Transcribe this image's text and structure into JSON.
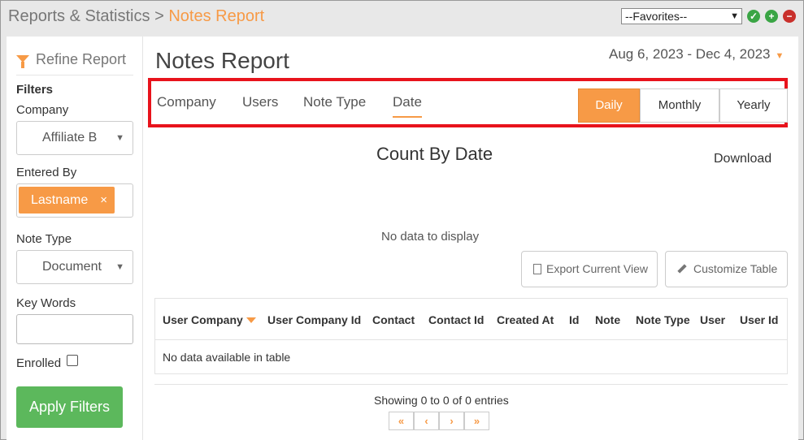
{
  "breadcrumb": {
    "parent": "Reports & Statistics",
    "separator": ">",
    "current": "Notes Report"
  },
  "favorites": {
    "selected": "--Favorites--"
  },
  "sidebar": {
    "refine_title": "Refine Report",
    "filters_label": "Filters",
    "company_label": "Company",
    "company_value": "Affiliate B",
    "entered_by_label": "Entered By",
    "entered_by_tag": "Lastname",
    "entered_by_remove": "×",
    "note_type_label": "Note Type",
    "note_type_value": "Document",
    "key_words_label": "Key Words",
    "key_words_value": "",
    "enrolled_label": "Enrolled",
    "apply_label": "Apply Filters"
  },
  "main": {
    "title": "Notes Report",
    "date_range": "Aug 6, 2023 - Dec 4, 2023",
    "tabs": [
      {
        "label": "Company"
      },
      {
        "label": "Users"
      },
      {
        "label": "Note Type"
      },
      {
        "label": "Date"
      }
    ],
    "active_tab": "Date",
    "periods": [
      {
        "label": "Daily",
        "active": true
      },
      {
        "label": "Monthly",
        "active": false
      },
      {
        "label": "Yearly",
        "active": false
      }
    ],
    "chart_title": "Count By Date",
    "download_label": "Download",
    "no_data_chart": "No data to display",
    "export_label": "Export Current View",
    "customize_label": "Customize Table"
  },
  "table": {
    "columns": [
      "User Company",
      "User Company Id",
      "Contact",
      "Contact Id",
      "Created At",
      "Id",
      "Note",
      "Note Type",
      "User",
      "User Id"
    ],
    "empty_message": "No data available in table",
    "showing": "Showing 0 to 0 of 0 entries"
  },
  "pagination": {
    "first": "«",
    "prev": "‹",
    "next": "›",
    "last": "»"
  },
  "colors": {
    "accent": "#f79a46",
    "highlight": "#e8131c",
    "apply": "#5cb85c"
  }
}
